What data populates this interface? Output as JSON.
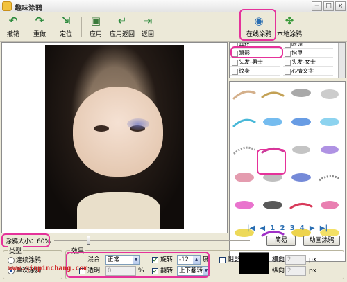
{
  "window": {
    "title": "趣味涂鸦",
    "min": "−",
    "max": "□",
    "close": "×"
  },
  "toolbar": {
    "undo": "撤销",
    "redo": "重做",
    "locate": "定位",
    "apply": "应用",
    "apply_back": "应用返回",
    "back": "返回",
    "online_doodle": "在线涂鸦",
    "local_doodle": "本地涂鸦"
  },
  "icons": {
    "undo": "undo-icon",
    "redo": "redo-icon",
    "locate": "locate-icon",
    "apply": "apply-icon",
    "apply_back": "apply-back-icon",
    "back": "exit-icon",
    "online": "globe-icon",
    "local": "clover-icon"
  },
  "colors": {
    "highlight": "#e5329a",
    "page_link": "#2a6eb2",
    "shadow": "#000000"
  },
  "categories": {
    "items": [
      "耳环",
      "眼镜",
      "眼影",
      "指甲",
      "头发-男士",
      "头发-女士",
      "纹身",
      "心情文字"
    ],
    "selected": "眼影"
  },
  "pager": {
    "first": "|◀",
    "prev": "◀",
    "pages": [
      "1",
      "2",
      "3",
      "4"
    ],
    "current": "1",
    "next": "▶",
    "last": "▶|"
  },
  "brush_size": {
    "label": "涂鸦大小：60%",
    "value": 0.6
  },
  "buttons": {
    "simple": "简易",
    "animated": "动画涂鸦"
  },
  "type_group": {
    "title": "类型",
    "continuous": "连续涂鸦",
    "single": "单次涂鸦",
    "selected": "单次涂鸦"
  },
  "effect_group": {
    "title": "效果",
    "blend_label": "混合",
    "blend_value": "正常",
    "transparent_label": "透明",
    "transparent_value": "0",
    "percent": "%",
    "rotate_label": "旋转",
    "rotate_value": "-12",
    "degree": "度",
    "flip_label": "翻转",
    "flip_value": "上下翻转",
    "shadow_label": "阴影",
    "horizontal_label": "横向",
    "horizontal_value": "2",
    "vertical_label": "纵向",
    "vertical_value": "2",
    "px": "px"
  },
  "watermark": "www.qinpinchang.com"
}
